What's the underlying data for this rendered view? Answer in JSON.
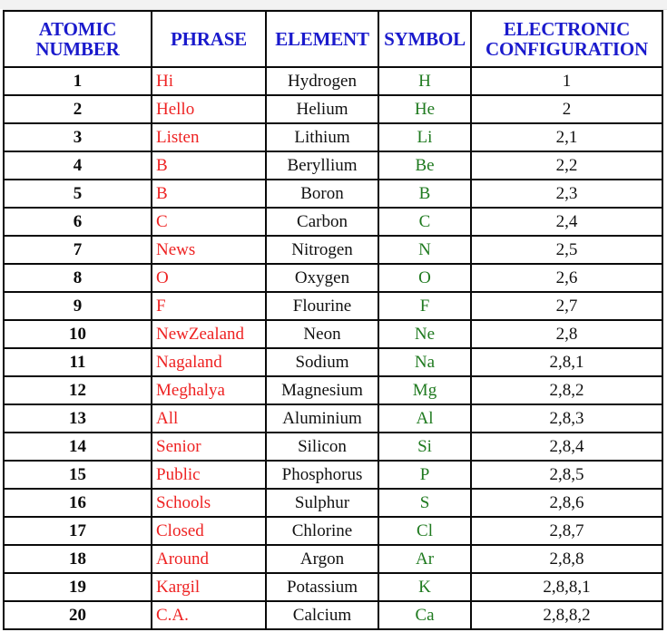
{
  "table": {
    "columns": [
      {
        "key": "atomic_number",
        "label": "ATOMIC NUMBER",
        "label_line1": "ATOMIC",
        "label_line2": "NUMBER"
      },
      {
        "key": "phrase",
        "label": "PHRASE",
        "label_line1": "PHRASE",
        "label_line2": ""
      },
      {
        "key": "element",
        "label": "ELEMENT",
        "label_line1": "ELEMENT",
        "label_line2": ""
      },
      {
        "key": "symbol",
        "label": "SYMBOL",
        "label_line1": "SYMBOL",
        "label_line2": ""
      },
      {
        "key": "electronic_configuration",
        "label": "ELECTRONIC CONFIGURATION",
        "label_line1": "ELECTRONIC",
        "label_line2": "CONFIGURATION"
      }
    ],
    "colors": {
      "header_text": "#1a1acc",
      "phrase_text": "#ee2222",
      "symbol_text": "#1f7a1f",
      "body_text": "#111111",
      "border": "#0a0a0a",
      "background": "#ffffff"
    },
    "rows": [
      {
        "atomic_number": "1",
        "phrase": "Hi",
        "element": "Hydrogen",
        "symbol": "H",
        "electronic_configuration": "1"
      },
      {
        "atomic_number": "2",
        "phrase": "Hello",
        "element": "Helium",
        "symbol": "He",
        "electronic_configuration": "2"
      },
      {
        "atomic_number": "3",
        "phrase": "Listen",
        "element": "Lithium",
        "symbol": "Li",
        "electronic_configuration": "2,1"
      },
      {
        "atomic_number": "4",
        "phrase": "B",
        "element": "Beryllium",
        "symbol": "Be",
        "electronic_configuration": "2,2"
      },
      {
        "atomic_number": "5",
        "phrase": "B",
        "element": "Boron",
        "symbol": "B",
        "electronic_configuration": "2,3"
      },
      {
        "atomic_number": "6",
        "phrase": "C",
        "element": "Carbon",
        "symbol": "C",
        "electronic_configuration": "2,4"
      },
      {
        "atomic_number": "7",
        "phrase": "News",
        "element": "Nitrogen",
        "symbol": "N",
        "electronic_configuration": "2,5"
      },
      {
        "atomic_number": "8",
        "phrase": "O",
        "element": "Oxygen",
        "symbol": "O",
        "electronic_configuration": "2,6"
      },
      {
        "atomic_number": "9",
        "phrase": "F",
        "element": "Flourine",
        "symbol": "F",
        "electronic_configuration": "2,7"
      },
      {
        "atomic_number": "10",
        "phrase": "NewZealand",
        "element": "Neon",
        "symbol": "Ne",
        "electronic_configuration": "2,8"
      },
      {
        "atomic_number": "11",
        "phrase": "Nagaland",
        "element": "Sodium",
        "symbol": "Na",
        "electronic_configuration": "2,8,1"
      },
      {
        "atomic_number": "12",
        "phrase": "Meghalya",
        "element": "Magnesium",
        "symbol": "Mg",
        "electronic_configuration": "2,8,2"
      },
      {
        "atomic_number": "13",
        "phrase": "All",
        "element": "Aluminium",
        "symbol": "Al",
        "electronic_configuration": "2,8,3"
      },
      {
        "atomic_number": "14",
        "phrase": "Senior",
        "element": "Silicon",
        "symbol": "Si",
        "electronic_configuration": "2,8,4"
      },
      {
        "atomic_number": "15",
        "phrase": "Public",
        "element": "Phosphorus",
        "symbol": "P",
        "electronic_configuration": "2,8,5"
      },
      {
        "atomic_number": "16",
        "phrase": "Schools",
        "element": "Sulphur",
        "symbol": "S",
        "electronic_configuration": "2,8,6"
      },
      {
        "atomic_number": "17",
        "phrase": "Closed",
        "element": "Chlorine",
        "symbol": "Cl",
        "electronic_configuration": "2,8,7"
      },
      {
        "atomic_number": "18",
        "phrase": "Around",
        "element": "Argon",
        "symbol": "Ar",
        "electronic_configuration": "2,8,8"
      },
      {
        "atomic_number": "19",
        "phrase": "Kargil",
        "element": "Potassium",
        "symbol": "K",
        "electronic_configuration": "2,8,8,1"
      },
      {
        "atomic_number": "20",
        "phrase": "C.A.",
        "element": "Calcium",
        "symbol": "Ca",
        "electronic_configuration": "2,8,8,2"
      }
    ]
  }
}
